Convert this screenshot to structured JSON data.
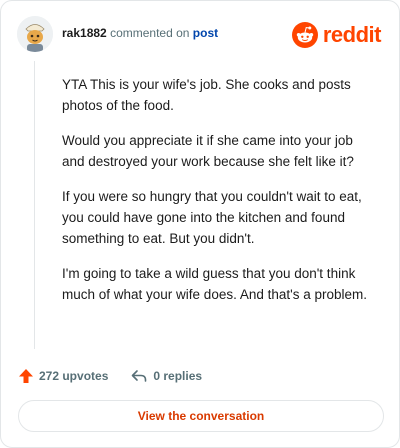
{
  "comment": {
    "username": "rak1882",
    "action_text": "commented on",
    "post_link": "post",
    "paragraphs": [
      "YTA This is your wife's job. She cooks and posts photos of the food.",
      "Would you appreciate it if she came into your job and destroyed your work because she felt like it?",
      "If you were so hungry that you couldn't wait to eat, you could have gone into the kitchen and found something to eat. But you didn't.",
      "I'm going to take a wild guess that you don't think much of what your wife does. And that's a problem."
    ]
  },
  "brand": {
    "name": "reddit",
    "color": "#ff4500"
  },
  "stats": {
    "upvotes": "272 upvotes",
    "replies": "0 replies"
  },
  "cta": {
    "label": "View the conversation"
  },
  "icons": {
    "upvote": "upvote-arrow-icon",
    "reply": "reply-arrow-icon",
    "logo": "reddit-snoo-icon",
    "avatar": "avatar"
  }
}
